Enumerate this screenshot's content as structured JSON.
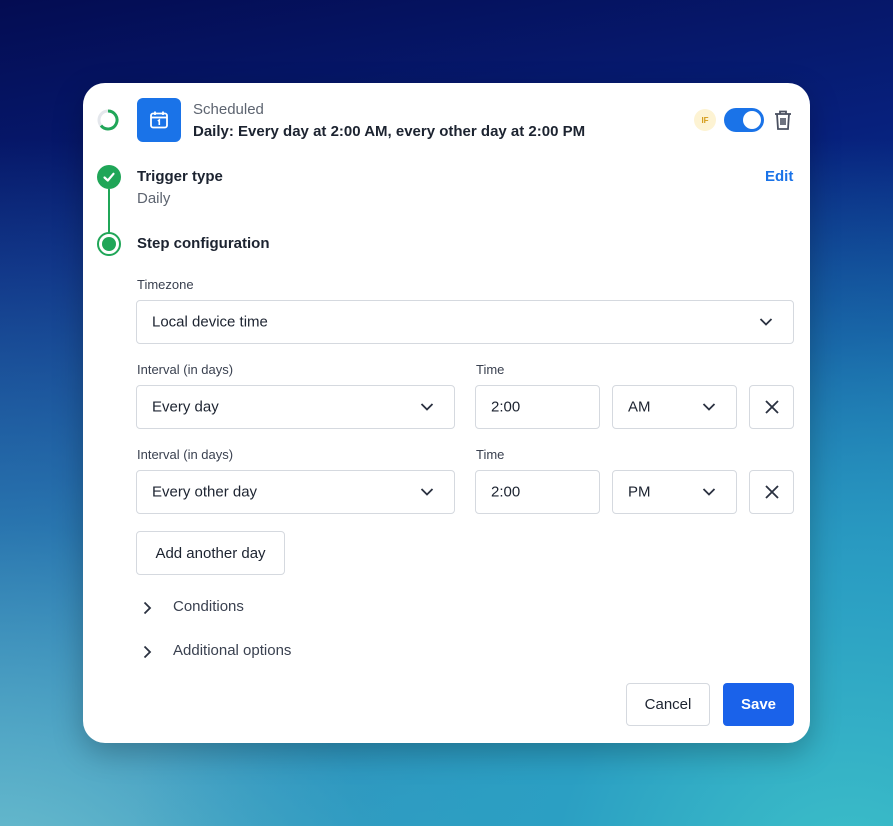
{
  "header": {
    "subtitle": "Scheduled",
    "title": "Daily: Every day at 2:00 AM, every other day at 2:00 PM",
    "badge": "IF",
    "enabled": true
  },
  "trigger": {
    "label": "Trigger type",
    "value": "Daily",
    "edit_label": "Edit"
  },
  "step": {
    "label": "Step configuration"
  },
  "timezone": {
    "label": "Timezone",
    "value": "Local device time"
  },
  "schedules": [
    {
      "interval_label": "Interval (in days)",
      "interval_value": "Every day",
      "time_label": "Time",
      "time_value": "2:00",
      "ampm": "AM"
    },
    {
      "interval_label": "Interval (in days)",
      "interval_value": "Every other day",
      "time_label": "Time",
      "time_value": "2:00",
      "ampm": "PM"
    }
  ],
  "add_day_label": "Add another day",
  "sections": {
    "conditions": "Conditions",
    "additional": "Additional options"
  },
  "footer": {
    "cancel": "Cancel",
    "save": "Save"
  },
  "colors": {
    "accent": "#1a73e8",
    "success": "#20a658"
  }
}
